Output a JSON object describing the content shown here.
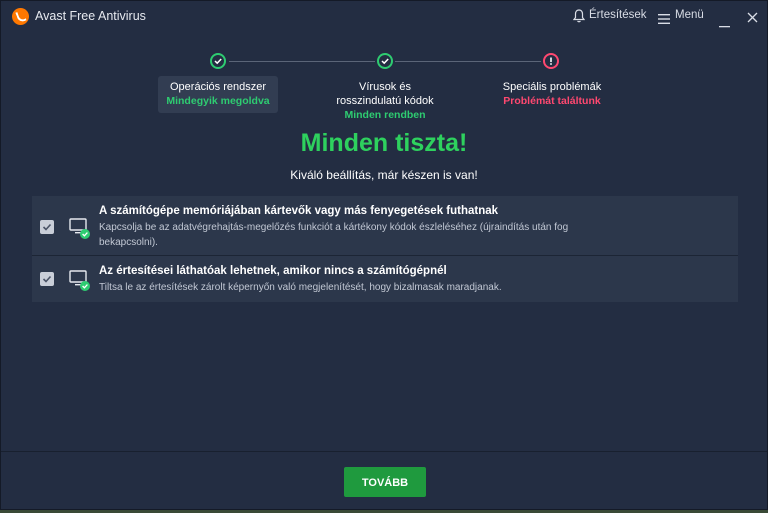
{
  "titlebar": {
    "app_title": "Avast Free Antivirus",
    "notifications_label": "Értesítések",
    "menu_label": "Menü"
  },
  "steps": [
    {
      "label": "Operációs rendszer",
      "status": "Mindegyik megoldva",
      "state": "done",
      "icon": "check-icon"
    },
    {
      "label": "Vírusok és rosszindulatú kódok",
      "status": "Minden rendben",
      "state": "done",
      "icon": "check-icon"
    },
    {
      "label": "Speciális problémák",
      "status": "Problémát találtunk",
      "state": "warning",
      "icon": "exclamation-icon"
    }
  ],
  "headline": "Minden tiszta!",
  "subheadline": "Kiváló beállítás, már készen is van!",
  "issues": [
    {
      "title": "A számítógépe memóriájában kártevők vagy más fenyegetések futhatnak",
      "description": "Kapcsolja be az adatvégrehajtás-megelőzés funkciót a kártékony kódok észleléséhez (újraindítás után fog bekapcsolni).",
      "checked": true,
      "icon": "monitor-check-icon"
    },
    {
      "title": "Az értesítései láthatóak lehetnek, amikor nincs a számítógépnél",
      "description": "Tiltsa le az értesítések zárolt képernyőn való megjelenítését, hogy bizalmasak maradjanak.",
      "checked": true,
      "icon": "monitor-check-icon"
    }
  ],
  "continue_button": "TOVÁBB",
  "colors": {
    "background": "#232d42",
    "success": "#2ecc71",
    "warning": "#ff4870",
    "button": "#1f9a3e",
    "brand": "#ff7800"
  }
}
